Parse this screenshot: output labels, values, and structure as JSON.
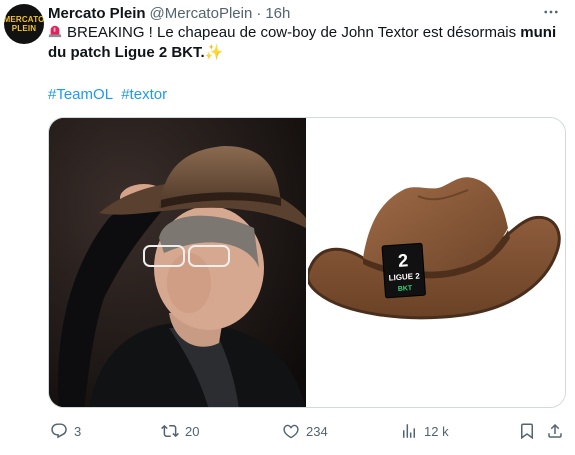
{
  "author": {
    "name": "Mercato Plein",
    "handle": "@MercatoPlein",
    "separator": "·",
    "time": "16h",
    "avatar_line1": "MERCATO",
    "avatar_line2": "PLEIN"
  },
  "tweet": {
    "text_plain": "BREAKING ! Le chapeau de cow-boy de John Textor est désormais ",
    "text_bold": "muni du patch Ligue 2 BKT.",
    "sparkle": "✨",
    "hashtags": [
      "#TeamOL",
      "#textor"
    ]
  },
  "media": {
    "left_photo": "man-in-cowboy-hat-photo",
    "right_photo": "cowboy-hat-with-patch-photo",
    "patch_number": "2",
    "patch_line1": "LIGUE 2",
    "patch_line2": "BKT"
  },
  "actions": {
    "replies": "3",
    "reposts": "20",
    "likes": "234",
    "views": "12 k"
  },
  "icons": {
    "more": "more-options-icon",
    "reply": "reply-icon",
    "repost": "repost-icon",
    "like": "like-icon",
    "views": "views-icon",
    "bookmark": "bookmark-icon",
    "share": "share-icon",
    "siren": "siren-emoji-icon"
  },
  "colors": {
    "link": "#1d9bf0",
    "muted": "#536471",
    "text": "#0f1419",
    "hat_brown": "#8b5a3c"
  }
}
